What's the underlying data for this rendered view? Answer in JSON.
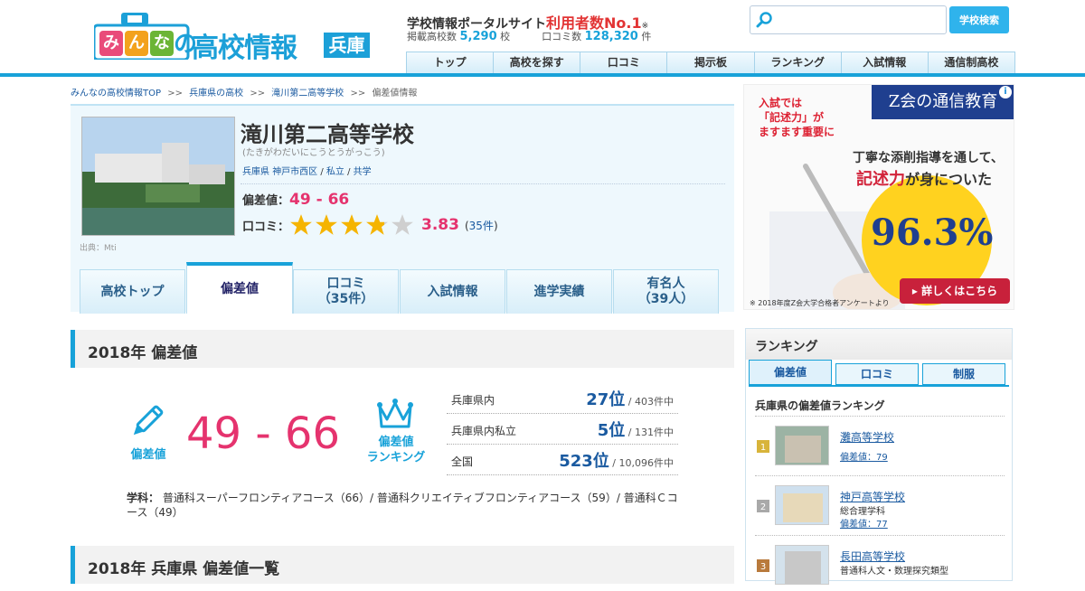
{
  "header": {
    "logo_text": "みんなの高校情報",
    "logo_pref": "兵庫",
    "portal_prefix": "学校情報ポータルサイト",
    "portal_highlight": "利用者数No.1",
    "portal_mark": "※",
    "stats_schools_label": "掲載高校数",
    "stats_schools_value": "5,290",
    "stats_schools_unit": "校",
    "stats_reviews_label": "口コミ数",
    "stats_reviews_value": "128,320",
    "stats_reviews_unit": "件",
    "search_placeholder": "",
    "search_button": "学校検索"
  },
  "nav": [
    "トップ",
    "高校を探す",
    "口コミ",
    "掲示板",
    "ランキング",
    "入試情報",
    "通信制高校"
  ],
  "breadcrumb": [
    "みんなの高校情報TOP",
    "兵庫県の高校",
    "滝川第二高等学校",
    "偏差値情報"
  ],
  "breadcrumb_sep": ">>",
  "school": {
    "name": "滝川第二高等学校",
    "kana": "(たきがわだいにこうとうがっこう)",
    "tags": [
      "兵庫県",
      "神戸市西区",
      "私立",
      "共学"
    ],
    "photo_credit_label": "出典：",
    "photo_credit_link": "Mti",
    "dev_label": "偏差値：",
    "dev_value": "49 - 66",
    "review_label": "口コミ：",
    "rating": 3.83,
    "rating_text": "3.83",
    "review_count": "35件"
  },
  "tabs": [
    {
      "label": "高校トップ"
    },
    {
      "label": "偏差値"
    },
    {
      "label": "口コミ\n（35件）"
    },
    {
      "label": "入試情報"
    },
    {
      "label": "進学実績"
    },
    {
      "label": "有名人\n（39人）"
    }
  ],
  "section1": {
    "title": "2018年 偏差値",
    "dev_label": "偏差値",
    "dev_value": "49 - 66",
    "rank_label": "偏差値\nランキング",
    "ranks": [
      {
        "label": "兵庫県内",
        "rank": "27位",
        "total": "/ 403件中"
      },
      {
        "label": "兵庫県内私立",
        "rank": "5位",
        "total": "/ 131件中"
      },
      {
        "label": "全国",
        "rank": "523位",
        "total": "/ 10,096件中"
      }
    ],
    "course_label": "学科",
    "course_text": "普通科スーパーフロンティアコース（66）/ 普通科クリエイティブフロンティアコース（59）/ 普通科Ｃコース（49）"
  },
  "section2": {
    "title": "2018年 兵庫県 偏差値一覧"
  },
  "ad": {
    "top_text": "入試では\n「記述力」が\nますます重要に",
    "logo": "Z会の通信教育",
    "info": "i",
    "line2": "丁寧な添削指導を通して、",
    "line3_red": "記述力",
    "line3_rest": "が身についた",
    "percent": "96.3%",
    "button": "詳しくはこちら",
    "footnote": "※ 2018年度Z会大学合格者アンケートより"
  },
  "ranking": {
    "title": "ランキング",
    "tabs": [
      "偏差値",
      "口コミ",
      "制服"
    ],
    "subtitle": "兵庫県の偏差値ランキング",
    "items": [
      {
        "rank": "1",
        "name": "灘高等学校",
        "sub": "",
        "value": "偏差値：79"
      },
      {
        "rank": "2",
        "name": "神戸高等学校",
        "sub": "総合理学科",
        "value": "偏差値：77"
      },
      {
        "rank": "3",
        "name": "長田高等学校",
        "sub": "普通科人文・数理探究類型",
        "value": ""
      }
    ]
  },
  "colors": {
    "accent": "#18a2d9",
    "pink": "#e5336e",
    "star": "#f5b400"
  }
}
